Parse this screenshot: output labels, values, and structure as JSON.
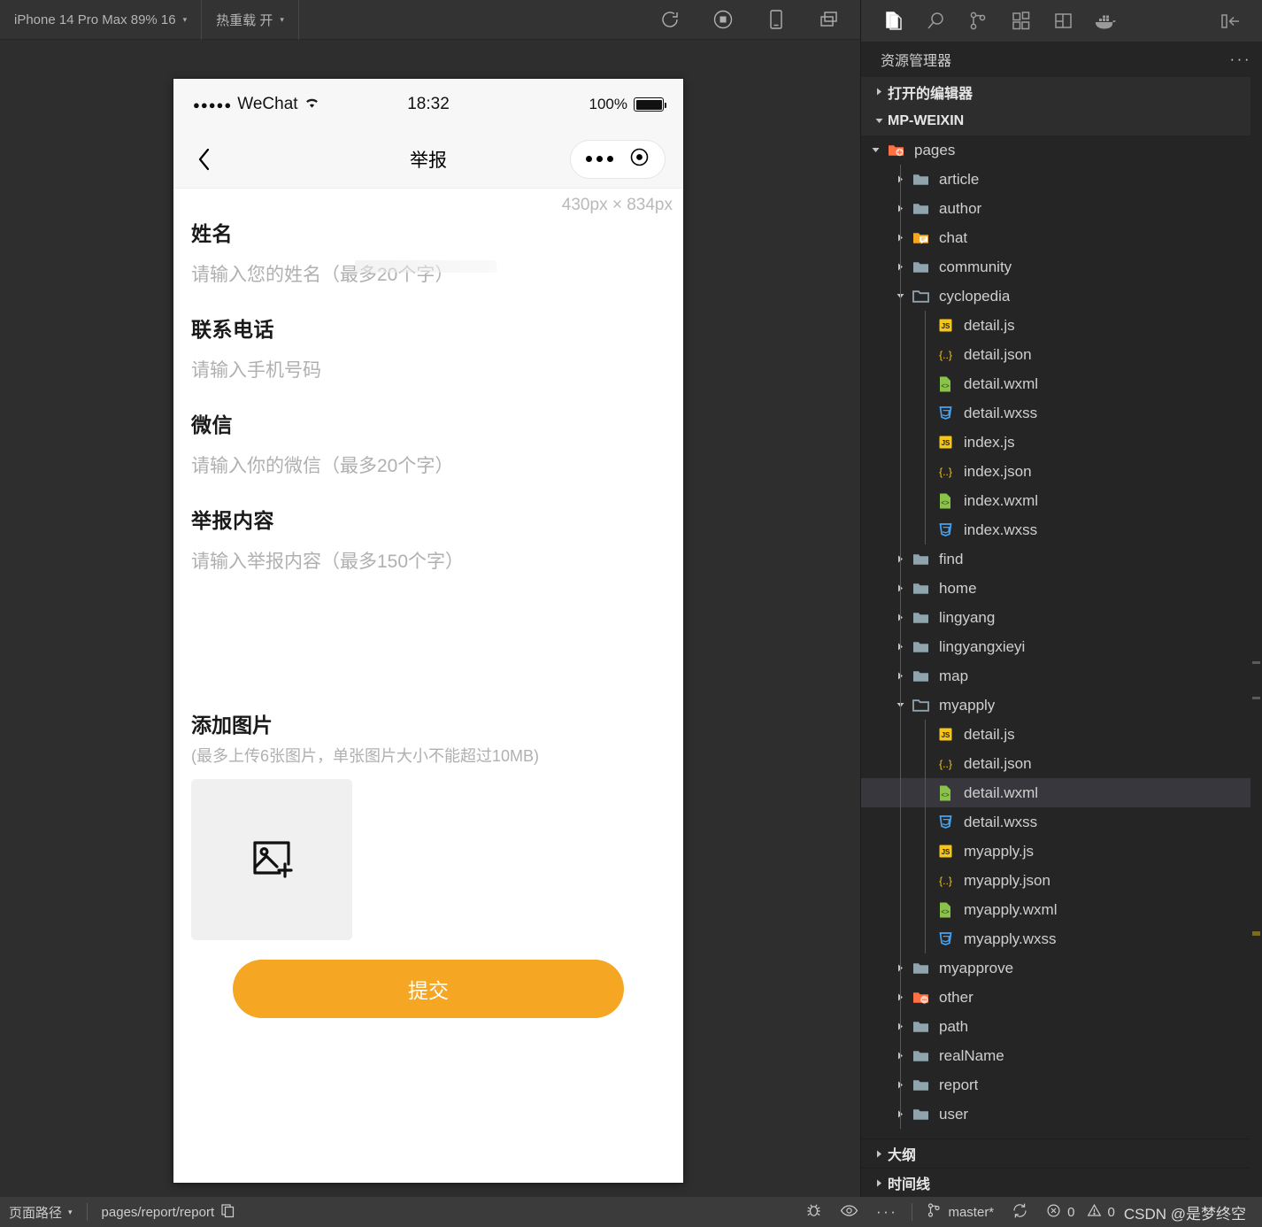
{
  "simulator": {
    "toolbar": {
      "device": "iPhone 14 Pro Max 89% 16",
      "device_caret": "▾",
      "hot_reload": "热重载 开",
      "hot_reload_caret": "▾",
      "icons": [
        {
          "name": "refresh-icon",
          "title": "刷新"
        },
        {
          "name": "stop-record-icon",
          "title": "停止"
        },
        {
          "name": "device-icon",
          "title": "设备"
        },
        {
          "name": "window-icon",
          "title": "窗口"
        }
      ]
    },
    "size_label": "430px × 834px"
  },
  "phone": {
    "statusbar": {
      "signal_dots": "●●●●●",
      "carrier": "WeChat",
      "wifi_icon": "wifi-icon",
      "time": "18:32",
      "battery_percent": "100%"
    },
    "navbar": {
      "back_icon": "chevron-left-icon",
      "title": "举报",
      "capsule_more_icon": "more-dots-icon",
      "capsule_target_icon": "target-icon"
    },
    "form": {
      "fields": [
        {
          "label": "姓名",
          "placeholder": "请输入您的姓名（最多20个字）",
          "type": "input"
        },
        {
          "label": "联系电话",
          "placeholder": "请输入手机号码",
          "type": "input"
        },
        {
          "label": "微信",
          "placeholder": "请输入你的微信（最多20个字）",
          "type": "input"
        },
        {
          "label": "举报内容",
          "placeholder": "请输入举报内容（最多150个字）",
          "type": "textarea"
        }
      ],
      "upload": {
        "title": "添加图片",
        "hint": "(最多上传6张图片，单张图片大小不能超过10MB)",
        "add_icon": "image-add-icon"
      },
      "submit_label": "提交",
      "submit_color": "#f5a623"
    }
  },
  "vscode": {
    "activitybar": [
      {
        "name": "explorer-icon",
        "active": true
      },
      {
        "name": "search-icon",
        "active": false
      },
      {
        "name": "source-control-icon",
        "active": false
      },
      {
        "name": "extensions-icon",
        "active": false
      },
      {
        "name": "layout-icon",
        "active": false
      },
      {
        "name": "docker-icon",
        "active": false
      },
      {
        "name": "collapse-panel-icon",
        "active": false
      }
    ],
    "panel_title": "资源管理器",
    "panel_more": "···",
    "sections": {
      "open_editors": "打开的编辑器",
      "workspace": "MP-WEIXIN",
      "outline": "大纲",
      "timeline": "时间线"
    },
    "tree": [
      {
        "label": "pages",
        "depth": 1,
        "kind": "folder-special",
        "state": "open"
      },
      {
        "label": "article",
        "depth": 2,
        "kind": "folder",
        "state": "closed"
      },
      {
        "label": "author",
        "depth": 2,
        "kind": "folder",
        "state": "closed"
      },
      {
        "label": "chat",
        "depth": 2,
        "kind": "folder-chat",
        "state": "closed"
      },
      {
        "label": "community",
        "depth": 2,
        "kind": "folder",
        "state": "closed"
      },
      {
        "label": "cyclopedia",
        "depth": 2,
        "kind": "folder-open",
        "state": "open"
      },
      {
        "label": "detail.js",
        "depth": 3,
        "kind": "js",
        "state": "file"
      },
      {
        "label": "detail.json",
        "depth": 3,
        "kind": "json",
        "state": "file"
      },
      {
        "label": "detail.wxml",
        "depth": 3,
        "kind": "wxml",
        "state": "file"
      },
      {
        "label": "detail.wxss",
        "depth": 3,
        "kind": "wxss",
        "state": "file"
      },
      {
        "label": "index.js",
        "depth": 3,
        "kind": "js",
        "state": "file"
      },
      {
        "label": "index.json",
        "depth": 3,
        "kind": "json",
        "state": "file"
      },
      {
        "label": "index.wxml",
        "depth": 3,
        "kind": "wxml",
        "state": "file"
      },
      {
        "label": "index.wxss",
        "depth": 3,
        "kind": "wxss",
        "state": "file"
      },
      {
        "label": "find",
        "depth": 2,
        "kind": "folder",
        "state": "closed"
      },
      {
        "label": "home",
        "depth": 2,
        "kind": "folder",
        "state": "closed"
      },
      {
        "label": "lingyang",
        "depth": 2,
        "kind": "folder",
        "state": "closed"
      },
      {
        "label": "lingyangxieyi",
        "depth": 2,
        "kind": "folder",
        "state": "closed"
      },
      {
        "label": "map",
        "depth": 2,
        "kind": "folder",
        "state": "closed"
      },
      {
        "label": "myapply",
        "depth": 2,
        "kind": "folder-open",
        "state": "open"
      },
      {
        "label": "detail.js",
        "depth": 3,
        "kind": "js",
        "state": "file"
      },
      {
        "label": "detail.json",
        "depth": 3,
        "kind": "json",
        "state": "file"
      },
      {
        "label": "detail.wxml",
        "depth": 3,
        "kind": "wxml",
        "state": "file",
        "selected": true
      },
      {
        "label": "detail.wxss",
        "depth": 3,
        "kind": "wxss",
        "state": "file"
      },
      {
        "label": "myapply.js",
        "depth": 3,
        "kind": "js",
        "state": "file"
      },
      {
        "label": "myapply.json",
        "depth": 3,
        "kind": "json",
        "state": "file"
      },
      {
        "label": "myapply.wxml",
        "depth": 3,
        "kind": "wxml",
        "state": "file"
      },
      {
        "label": "myapply.wxss",
        "depth": 3,
        "kind": "wxss",
        "state": "file"
      },
      {
        "label": "myapprove",
        "depth": 2,
        "kind": "folder",
        "state": "closed"
      },
      {
        "label": "other",
        "depth": 2,
        "kind": "folder-other",
        "state": "closed"
      },
      {
        "label": "path",
        "depth": 2,
        "kind": "folder",
        "state": "closed"
      },
      {
        "label": "realName",
        "depth": 2,
        "kind": "folder",
        "state": "closed"
      },
      {
        "label": "report",
        "depth": 2,
        "kind": "folder",
        "state": "closed"
      },
      {
        "label": "user",
        "depth": 2,
        "kind": "folder",
        "state": "closed"
      }
    ]
  },
  "statusbar": {
    "page_path_label": "页面路径",
    "page_path_caret": "▾",
    "page_path_value": "pages/report/report",
    "copy_icon": "copy-icon",
    "debug_icon": "bug-icon",
    "preview_icon": "eye-icon",
    "more_icon": "ellipsis-icon",
    "branch_icon": "git-branch-icon",
    "branch": "master*",
    "sync_icon": "sync-icon",
    "error_icon": "error-circle-icon",
    "errors": "0",
    "warning_icon": "warning-triangle-icon",
    "warnings": "0",
    "watermark": "CSDN @是梦终空"
  }
}
